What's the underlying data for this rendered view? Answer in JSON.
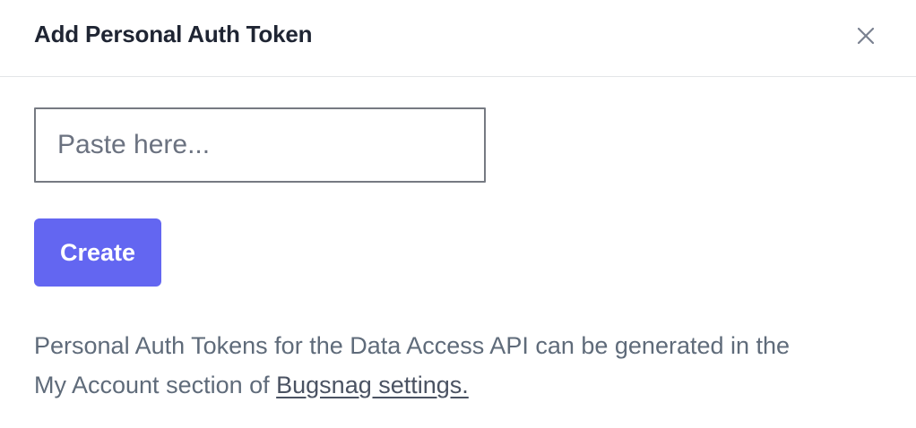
{
  "dialog": {
    "title": "Add Personal Auth Token",
    "close_icon": "close-icon"
  },
  "token_input": {
    "value": "",
    "placeholder": "Paste here..."
  },
  "create_button": {
    "label": "Create",
    "color": "#6366f1"
  },
  "help": {
    "line1": "Personal Auth Tokens for the Data Access API can be generated in the",
    "line2_prefix": "My Account section of ",
    "link_text": "Bugsnag settings."
  }
}
